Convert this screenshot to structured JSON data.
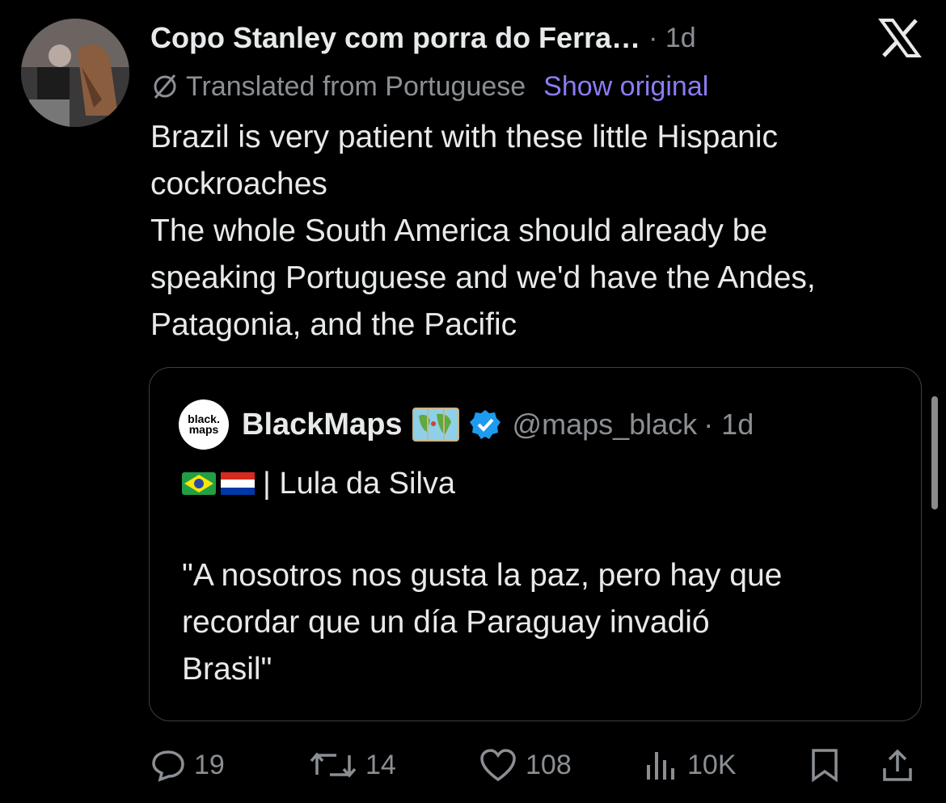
{
  "tweet": {
    "author": "Copo Stanley com porra do Ferra…",
    "time": "· 1d",
    "translated_label": "Translated from Portuguese",
    "show_original": "Show original",
    "text_lines": [
      "Brazil is very patient with these little Hispanic",
      "cockroaches",
      "The whole South America should already be",
      "speaking Portuguese and we'd have the Andes,",
      "Patagonia, and the Pacific"
    ]
  },
  "quote": {
    "name": "BlackMaps",
    "logo_text": [
      "black.",
      "maps"
    ],
    "handle": "@maps_black",
    "time": "· 1d",
    "line1": "| Lula da Silva",
    "flags": [
      "brazil-flag",
      "paraguay-flag"
    ],
    "body_lines": [
      "\"A nosotros nos gusta la paz, pero hay que",
      "recordar que un día Paraguay invadió",
      "Brasil\""
    ]
  },
  "actions": {
    "replies": "19",
    "retweets": "14",
    "likes": "108",
    "views": "10K"
  },
  "icons": {
    "app_logo": "x-logo-icon",
    "translate": "translate-icon",
    "verified": "verified-badge-icon",
    "map": "map-emoji-icon",
    "reply": "reply-icon",
    "retweet": "retweet-icon",
    "like": "heart-icon",
    "views": "views-icon",
    "bookmark": "bookmark-icon",
    "share": "share-icon"
  },
  "colors": {
    "background": "#000000",
    "text": "#e7e9ea",
    "muted": "#8b8f94",
    "link": "#8b7cf6",
    "verified": "#1d9bf0"
  }
}
